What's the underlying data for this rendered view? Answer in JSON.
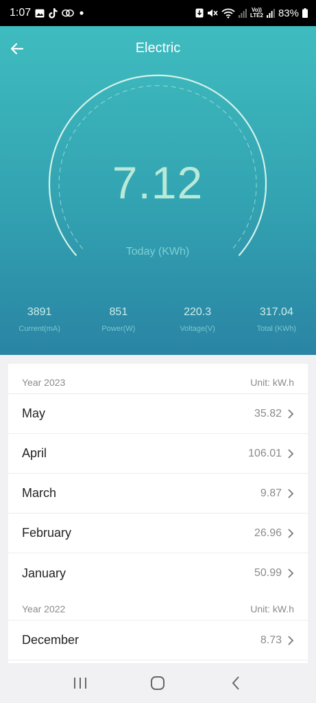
{
  "status_bar": {
    "time": "1:07",
    "battery": "83%",
    "network_label_top": "Vo))",
    "network_label_bottom": "LTE2"
  },
  "header": {
    "title": "Electric"
  },
  "gauge": {
    "value": "7.12",
    "label": "Today (KWh)"
  },
  "stats": [
    {
      "value": "3891",
      "label": "Current(mA)"
    },
    {
      "value": "851",
      "label": "Power(W)"
    },
    {
      "value": "220.3",
      "label": "Voltage(V)"
    },
    {
      "value": "317.04",
      "label": "Total (KWh)"
    }
  ],
  "history": {
    "sections": [
      {
        "year": "Year 2023",
        "unit": "Unit: kW.h",
        "rows": [
          {
            "month": "May",
            "value": "35.82"
          },
          {
            "month": "April",
            "value": "106.01"
          },
          {
            "month": "March",
            "value": "9.87"
          },
          {
            "month": "February",
            "value": "26.96"
          },
          {
            "month": "January",
            "value": "50.99"
          }
        ]
      },
      {
        "year": "Year 2022",
        "unit": "Unit: kW.h",
        "rows": [
          {
            "month": "December",
            "value": "8.73"
          }
        ]
      }
    ]
  },
  "colors": {
    "hero_top": "#3fbcbf",
    "hero_bottom": "#2a84a4",
    "gauge_value": "#b9e9d8",
    "page_bg": "#f1f1f3"
  }
}
